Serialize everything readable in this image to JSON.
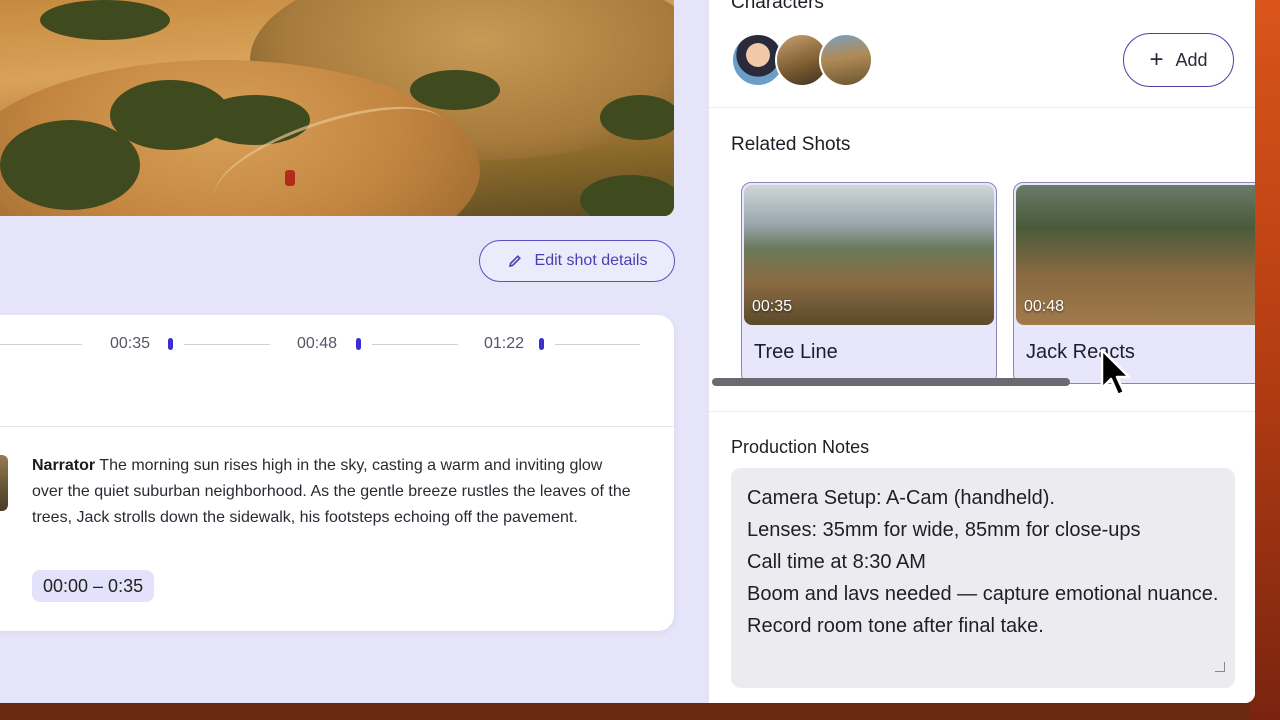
{
  "main": {
    "edit_button_label": "Edit shot details",
    "timeline": {
      "markers": [
        "00:35",
        "00:48",
        "01:22"
      ]
    },
    "script_entry": {
      "speaker": "Narrator",
      "text": "The morning sun rises high in the sky, casting a warm and inviting glow over the quiet suburban neighborhood. As the gentle breeze rustles the leaves of the trees, Jack strolls down the sidewalk, his footsteps echoing off the pavement.",
      "timecode": "00:00 – 0:35"
    }
  },
  "sidebar": {
    "characters_title": "Characters",
    "add_button_label": "Add",
    "related_title": "Related Shots",
    "related_shots": [
      {
        "time": "00:35",
        "name": "Tree Line"
      },
      {
        "time": "00:48",
        "name": "Jack Reacts"
      }
    ],
    "notes_title": "Production Notes",
    "notes_lines": [
      "Camera Setup: A-Cam (handheld).",
      "Lenses: 35mm for wide, 85mm for close-ups",
      "Call time at 8:30 AM",
      "Boom and lavs needed — capture emotional nuance.",
      "Record room tone after final take."
    ]
  },
  "colors": {
    "accent": "#4a3fb0",
    "window_bg": "#e6e4f8",
    "marker": "#3b2fd0"
  }
}
